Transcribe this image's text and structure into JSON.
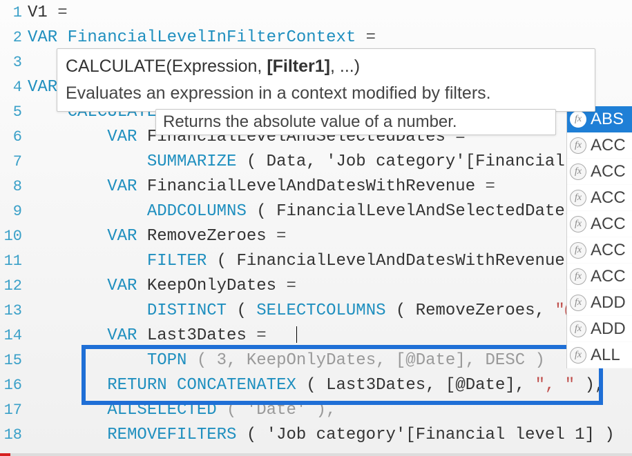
{
  "gutter": [
    "1",
    "2",
    "3",
    "4",
    "5",
    "6",
    "7",
    "8",
    "9",
    "10",
    "11",
    "12",
    "13",
    "14",
    "15",
    "16",
    "17",
    "18"
  ],
  "code": {
    "l1_ident": "V1",
    "l1_eq": " =",
    "l2_var": "VAR ",
    "l2_ident": "FinancialLevelInFilterContext",
    "l2_eq": " =",
    "l4_var": "VAR ",
    "l5_fn": "CALCULATE",
    "l5_open": " (",
    "l6_var": "VAR ",
    "l6_ident": "FinancialLevelAndSelectedDates",
    "l6_eq": " =",
    "l7_fn": "SUMMARIZE",
    "l7_rest": " ( Data, 'Job category'[Financial lev",
    "l8_var": "VAR ",
    "l8_ident": "FinancialLevelAndDatesWithRevenue",
    "l8_eq": " =",
    "l9_fn": "ADDCOLUMNS",
    "l9_rest1": " ( ",
    "l9_ident": "FinancialLevelAndSelectedDates",
    "l9_rest2": ", ",
    "l9_str": "\"",
    "l10_var": "VAR ",
    "l10_ident": "RemoveZeroes",
    "l10_eq": " =",
    "l11_fn": "FILTER",
    "l11_rest1": " ( ",
    "l11_ident": "FinancialLevelAndDatesWithRevenue",
    "l11_rest2": ", [@",
    "l12_var": "VAR ",
    "l12_ident": "KeepOnlyDates",
    "l12_eq": " =",
    "l13_fn1": "DISTINCT",
    "l13_mid": " ( ",
    "l13_fn2": "SELECTCOLUMNS",
    "l13_rest1": " ( ",
    "l13_ident": "RemoveZeroes",
    "l13_rest2": ", ",
    "l13_str": "\"@Dat",
    "l14_var": "VAR ",
    "l14_ident": "Last3Dates",
    "l14_eq": " =",
    "l15_fn": "TOPN",
    "l15_rest1": " ( 3, ",
    "l15_ident": "KeepOnlyDates",
    "l15_rest2": ", [@Date], ",
    "l15_desc": "DESC",
    "l15_rest3": " )",
    "l16_ret": "RETURN ",
    "l16_fn": "CONCATENATEX",
    "l16_rest1": " ( ",
    "l16_ident": "Last3Dates",
    "l16_rest2": ", [@Date], ",
    "l16_str": "\", \"",
    "l16_rest3": " ),",
    "l17_fn": "ALLSELECTED",
    "l17_rest": " ( 'Date' ),",
    "l18_fn": "REMOVEFILTERS",
    "l18_rest": " ( 'Job category'[Financial level 1] )"
  },
  "tooltip_big": {
    "sig_fn": "CALCULATE",
    "sig_rest_before": "(Expression, ",
    "sig_bold": "[Filter1]",
    "sig_rest_after": ", ...)",
    "desc": "Evaluates an expression in a context modified by filters."
  },
  "tooltip_small": "Returns the absolute value of a number.",
  "intellisense": {
    "items": [
      "ABS",
      "ACC",
      "ACC",
      "ACC",
      "ACC",
      "ACC",
      "ACC",
      "ADD",
      "ADD",
      "ALL"
    ],
    "fx_glyph": "fx"
  }
}
